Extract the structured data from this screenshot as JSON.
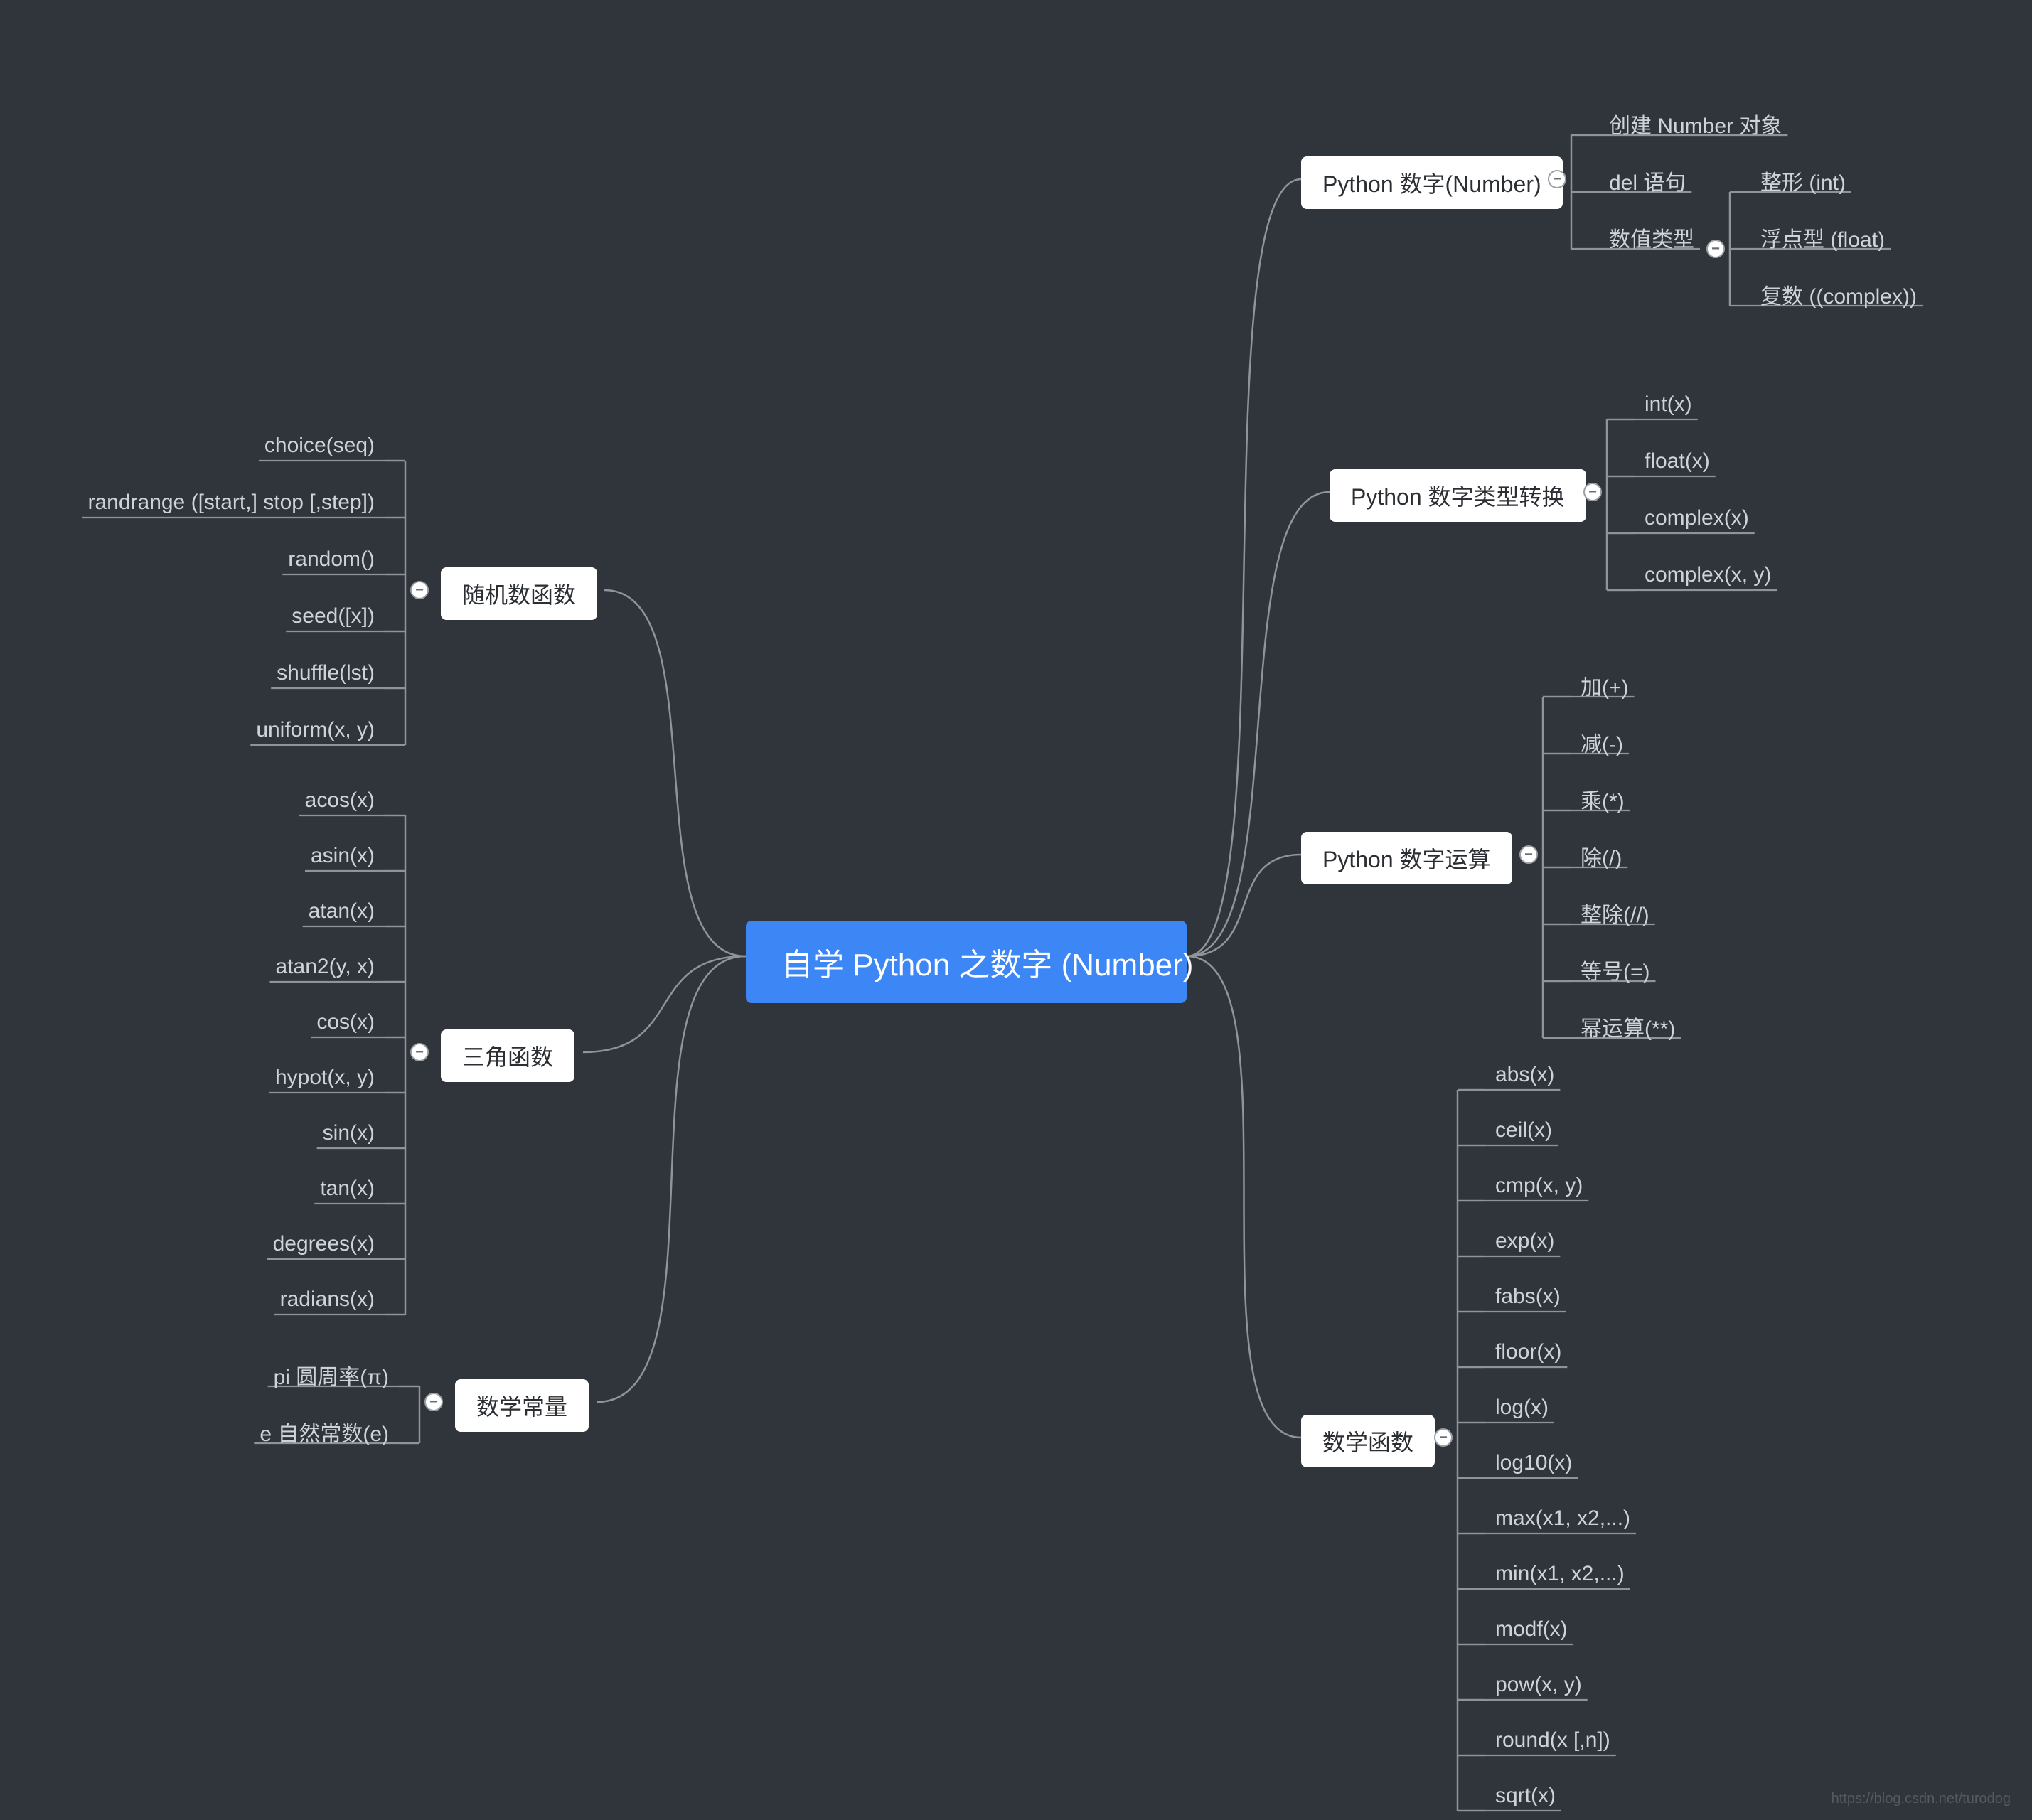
{
  "root": "自学 Python 之数字 (Number)",
  "watermark": "https://blog.csdn.net/turodog",
  "right": [
    {
      "key": "number",
      "label": "Python 数字(Number)",
      "children": [
        {
          "label": "创建 Number 对象"
        },
        {
          "label": "del 语句"
        },
        {
          "label": "数值类型",
          "children": [
            {
              "label": "整形 (int)"
            },
            {
              "label": "浮点型 (float)"
            },
            {
              "label": "复数 ((complex))"
            }
          ]
        }
      ]
    },
    {
      "key": "conv",
      "label": "Python 数字类型转换",
      "children": [
        {
          "label": "int(x)"
        },
        {
          "label": "float(x)"
        },
        {
          "label": "complex(x)"
        },
        {
          "label": "complex(x, y)"
        }
      ]
    },
    {
      "key": "ops",
      "label": "Python 数字运算",
      "children": [
        {
          "label": "加(+)"
        },
        {
          "label": "减(-)"
        },
        {
          "label": "乘(*)"
        },
        {
          "label": "除(/)"
        },
        {
          "label": "整除(//)"
        },
        {
          "label": "等号(=)"
        },
        {
          "label": "幂运算(**)"
        }
      ]
    },
    {
      "key": "math",
      "label": "数学函数",
      "children": [
        {
          "label": "abs(x)"
        },
        {
          "label": "ceil(x)"
        },
        {
          "label": "cmp(x, y)"
        },
        {
          "label": "exp(x)"
        },
        {
          "label": "fabs(x)"
        },
        {
          "label": "floor(x)"
        },
        {
          "label": "log(x)"
        },
        {
          "label": "log10(x)"
        },
        {
          "label": "max(x1, x2,...)"
        },
        {
          "label": "min(x1, x2,...)"
        },
        {
          "label": "modf(x)"
        },
        {
          "label": "pow(x, y)"
        },
        {
          "label": "round(x [,n])"
        },
        {
          "label": "sqrt(x)"
        }
      ]
    }
  ],
  "left": [
    {
      "key": "rand",
      "label": "随机数函数",
      "children": [
        {
          "label": "choice(seq)"
        },
        {
          "label": "randrange ([start,] stop [,step])"
        },
        {
          "label": "random()"
        },
        {
          "label": "seed([x])"
        },
        {
          "label": "shuffle(lst)"
        },
        {
          "label": "uniform(x, y)"
        }
      ]
    },
    {
      "key": "trig",
      "label": "三角函数",
      "children": [
        {
          "label": "acos(x)"
        },
        {
          "label": "asin(x)"
        },
        {
          "label": "atan(x)"
        },
        {
          "label": "atan2(y, x)"
        },
        {
          "label": "cos(x)"
        },
        {
          "label": "hypot(x, y)"
        },
        {
          "label": "sin(x)"
        },
        {
          "label": "tan(x)"
        },
        {
          "label": "degrees(x)"
        },
        {
          "label": "radians(x)"
        }
      ]
    },
    {
      "key": "const",
      "label": "数学常量",
      "children": [
        {
          "label": "pi 圆周率(π)"
        },
        {
          "label": "e 自然常数(e)"
        }
      ]
    }
  ]
}
